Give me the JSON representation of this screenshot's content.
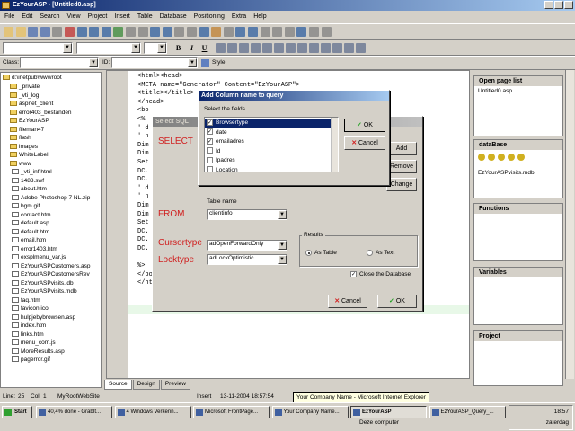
{
  "window": {
    "title": "EzYourASP - [Untitled0.asp]"
  },
  "menu": [
    "File",
    "Edit",
    "Search",
    "View",
    "Project",
    "Insert",
    "Table",
    "Database",
    "Positioning",
    "Extra",
    "Help"
  ],
  "toolbar3": {
    "class_label": "Class:",
    "id_label": "ID:",
    "style_label": "Style"
  },
  "tree": {
    "root": "d:\\inetpub\\wwwroot",
    "items": [
      "_private",
      "_vti_log",
      "aspnet_client",
      "error403_bestanden",
      "EzYourASP",
      "fileman47",
      "flash",
      "images",
      "WhiteLabel",
      "www",
      "_vti_inf.html",
      "1483.swf",
      "about.htm",
      "Adobe Photoshop 7 NL.zip",
      "bgm.gif",
      "contact.htm",
      "default.asp",
      "default.htm",
      "email.htm",
      "error1403.htm",
      "exsplmenu_var.js",
      "EzYourASPCustomers.asp",
      "EzYourASPCustomersRev",
      "EzYourASPvisits.ldb",
      "EzYourASPvisits.mdb",
      "faq.htm",
      "favicon.ico",
      "hulpjebybrowsen.asp",
      "index.htm",
      "links.htm",
      "menu_com.js",
      "MoreResults.asp",
      "pagerror.gif"
    ]
  },
  "code_lines": [
    "<html><head>",
    "<META name=\"Generator\" Content=\"EzYourASP\">",
    "<title></title>",
    "</head>",
    "<bo",
    "<%",
    "' d",
    "' n",
    "Dim",
    "Dim",
    "Set",
    "DC.",
    "DC.",
    "' d",
    "' n",
    "Dim",
    "Dim",
    "Set",
    "DC.",
    "DC.",
    "DC.",
    "",
    "%>",
    "</body>",
    "</html>"
  ],
  "editor_tabs": [
    "Source",
    "Design",
    "Preview"
  ],
  "panels": {
    "open_page_list": {
      "title": "Open page list",
      "items": [
        "Untitled0.asp"
      ]
    },
    "database": {
      "title": "dataBase",
      "items": [
        "EzYourASPvisits.mdb"
      ]
    },
    "functions": {
      "title": "Functions"
    },
    "variables": {
      "title": "Variables"
    },
    "project": {
      "title": "Project"
    }
  },
  "status": {
    "line": "Line:",
    "line_val": "25",
    "col": "Col:",
    "col_val": "1",
    "site": "MyRootWebSite",
    "mode": "Insert",
    "datetime": "13-11-2004 18:57:54"
  },
  "tooltip": "Your Company Name - Microsoft Internet Explorer",
  "select_sql": {
    "title": "Select SQL",
    "select_label": "SELECT",
    "from_label": "FROM",
    "table_name_label": "Table name",
    "table_value": "clientinfo",
    "cursortype_label": "Cursortype",
    "cursortype_value": "adOpenForwardOnly",
    "locktype_label": "Locktype",
    "locktype_value": "adLockOptimistic",
    "results_label": "Results",
    "as_table": "As Table",
    "as_text": "As Text",
    "close_db": "Close the Database",
    "add": "Add",
    "remove": "Remove",
    "change": "Change",
    "cancel": "Cancel",
    "ok": "OK"
  },
  "add_column": {
    "title": "Add Column name to query",
    "hint": "Select the fields.",
    "fields": [
      {
        "name": "Browsertype",
        "checked": true,
        "selected": true
      },
      {
        "name": "date",
        "checked": true
      },
      {
        "name": "emailadres",
        "checked": true
      },
      {
        "name": "Id",
        "checked": false
      },
      {
        "name": "Ipadres",
        "checked": false
      },
      {
        "name": "Location",
        "checked": false
      }
    ],
    "ok": "OK",
    "cancel": "Cancel"
  },
  "taskbar": {
    "start": "Start",
    "tasks": [
      "40,4% done - GrabIt...",
      "4 Windows Verkenn...",
      "Microsoft FrontPage...",
      "Your Company Name...",
      "EzYourASP",
      "EzYourASP_Query_..."
    ],
    "active_index": 4,
    "clock": "18:57",
    "day": "zaterdag",
    "desktop": "Deze computer"
  },
  "colors": {
    "title_active": "#0a246a",
    "accent_red": "#d02020",
    "ok_green": "#20a020"
  }
}
